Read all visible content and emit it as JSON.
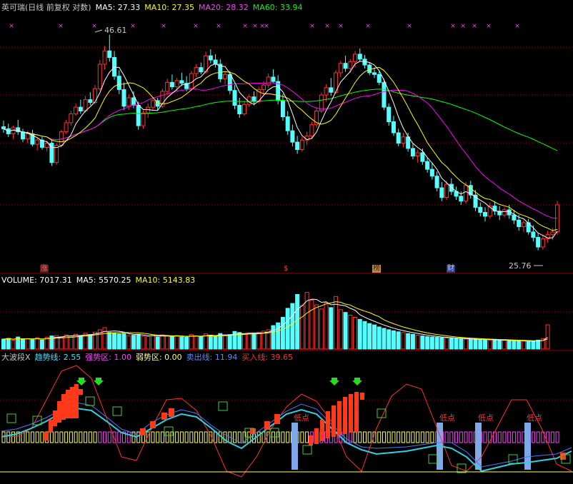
{
  "main": {
    "title": "英可瑞(日线 前复权 对数)",
    "ma5_label": "MA5: 27.33",
    "ma10_label": "MA10: 27.35",
    "ma20_label": "MA20: 28.32",
    "ma60_label": "MA60: 33.94",
    "high_annotation": "46.61",
    "low_annotation": "25.76",
    "event_tags": [
      "涨",
      "$",
      "榜",
      "财"
    ]
  },
  "volume": {
    "label_prefix": "VOLUME: 7017.31",
    "ma5_label": "MA5: 5570.25",
    "ma10_label": "MA10: 5143.83"
  },
  "indicator": {
    "name": "大波段X",
    "trend_label": "趋势线: 2.55",
    "strong_label": "强势区: 1.00",
    "weak_label": "弱势区: 0.00",
    "sell_label": "卖出线: 11.94",
    "buy_label": "买入线: 39.65",
    "low_point_text": "低点"
  },
  "colors": {
    "background": "#000000",
    "up": "#ff3232",
    "down": "#54ffff",
    "ma5": "#ffffff",
    "ma10": "#ffff00",
    "ma20": "#ff00ff",
    "ma60": "#00ff00",
    "grid": "#a00000",
    "trend": "#30d0e0",
    "sell": "#4a7aff",
    "buy": "#ff3030",
    "low_bar": "#7fa8e8"
  },
  "chart_data": {
    "type": "candlestick",
    "title": "英可瑞(日线 前复权 对数)",
    "price_range": [
      25.76,
      46.61
    ],
    "price_high": 46.61,
    "price_low": 25.76,
    "ohlc": [
      [
        36.2,
        36.8,
        35.6,
        36.0
      ],
      [
        36.0,
        36.5,
        35.2,
        35.5
      ],
      [
        35.5,
        36.3,
        35.0,
        36.1
      ],
      [
        36.1,
        36.9,
        35.4,
        35.7
      ],
      [
        35.7,
        36.0,
        34.7,
        35.0
      ],
      [
        35.0,
        35.8,
        34.6,
        35.5
      ],
      [
        35.5,
        35.9,
        34.3,
        34.5
      ],
      [
        34.5,
        35.1,
        33.9,
        34.9
      ],
      [
        34.9,
        35.2,
        34.0,
        34.2
      ],
      [
        34.2,
        34.8,
        33.8,
        34.6
      ],
      [
        34.6,
        35.0,
        32.5,
        32.8
      ],
      [
        32.8,
        34.6,
        32.6,
        34.4
      ],
      [
        34.4,
        35.9,
        34.2,
        35.7
      ],
      [
        35.7,
        36.9,
        35.5,
        36.6
      ],
      [
        36.6,
        37.8,
        36.3,
        37.5
      ],
      [
        37.5,
        38.6,
        37.3,
        38.2
      ],
      [
        38.2,
        39.0,
        37.5,
        37.8
      ],
      [
        37.8,
        39.4,
        37.6,
        39.0
      ],
      [
        39.0,
        39.8,
        38.4,
        38.7
      ],
      [
        38.7,
        40.6,
        38.5,
        40.2
      ],
      [
        40.2,
        43.5,
        40.0,
        43.0
      ],
      [
        43.0,
        45.2,
        42.4,
        44.6
      ],
      [
        44.6,
        46.61,
        43.3,
        43.8
      ],
      [
        43.8,
        44.6,
        41.2,
        41.6
      ],
      [
        41.6,
        42.3,
        39.6,
        40.1
      ],
      [
        40.1,
        40.9,
        37.9,
        38.3
      ],
      [
        38.3,
        39.6,
        37.9,
        39.2
      ],
      [
        39.2,
        39.9,
        38.1,
        38.4
      ],
      [
        38.4,
        38.8,
        35.9,
        36.3
      ],
      [
        36.3,
        37.9,
        36.0,
        37.6
      ],
      [
        37.6,
        38.6,
        37.1,
        38.2
      ],
      [
        38.2,
        39.2,
        37.8,
        38.9
      ],
      [
        38.9,
        39.2,
        37.9,
        38.3
      ],
      [
        38.3,
        40.2,
        38.1,
        39.9
      ],
      [
        39.9,
        41.3,
        39.5,
        40.9
      ],
      [
        40.9,
        41.8,
        40.1,
        40.4
      ],
      [
        40.4,
        41.4,
        39.9,
        41.1
      ],
      [
        41.1,
        42.0,
        40.5,
        40.8
      ],
      [
        40.8,
        41.6,
        39.9,
        40.2
      ],
      [
        40.2,
        42.2,
        40.0,
        41.9
      ],
      [
        41.9,
        43.0,
        41.5,
        42.6
      ],
      [
        42.6,
        43.2,
        41.8,
        42.1
      ],
      [
        42.1,
        44.5,
        41.9,
        44.0
      ],
      [
        44.0,
        44.8,
        43.1,
        43.5
      ],
      [
        43.5,
        44.2,
        42.6,
        43.0
      ],
      [
        43.0,
        43.6,
        40.9,
        41.3
      ],
      [
        41.3,
        42.1,
        40.7,
        41.8
      ],
      [
        41.8,
        42.2,
        39.6,
        40.0
      ],
      [
        40.0,
        40.6,
        38.0,
        38.4
      ],
      [
        38.4,
        39.2,
        37.1,
        37.5
      ],
      [
        37.5,
        38.8,
        37.3,
        38.5
      ],
      [
        38.5,
        39.6,
        38.2,
        39.3
      ],
      [
        39.3,
        39.9,
        38.4,
        38.8
      ],
      [
        38.8,
        40.4,
        38.6,
        40.1
      ],
      [
        40.1,
        41.0,
        39.6,
        40.6
      ],
      [
        40.6,
        41.9,
        40.3,
        41.5
      ],
      [
        41.5,
        42.4,
        40.8,
        41.0
      ],
      [
        41.0,
        41.7,
        38.5,
        38.9
      ],
      [
        38.9,
        39.6,
        36.8,
        37.2
      ],
      [
        37.2,
        37.8,
        35.4,
        35.8
      ],
      [
        35.8,
        36.4,
        34.3,
        34.7
      ],
      [
        34.7,
        35.3,
        33.6,
        34.0
      ],
      [
        34.0,
        35.2,
        33.8,
        34.9
      ],
      [
        34.9,
        35.7,
        34.4,
        35.3
      ],
      [
        35.3,
        36.7,
        35.0,
        36.4
      ],
      [
        36.4,
        38.1,
        36.1,
        37.8
      ],
      [
        37.8,
        39.8,
        37.6,
        39.5
      ],
      [
        39.5,
        40.7,
        38.8,
        40.3
      ],
      [
        40.3,
        41.4,
        39.4,
        39.8
      ],
      [
        39.8,
        42.3,
        39.6,
        42.0
      ],
      [
        42.0,
        43.4,
        41.5,
        43.1
      ],
      [
        43.1,
        44.0,
        42.1,
        42.5
      ],
      [
        42.5,
        43.6,
        42.0,
        43.3
      ],
      [
        43.3,
        44.6,
        42.6,
        44.2
      ],
      [
        44.2,
        44.9,
        43.3,
        43.6
      ],
      [
        43.6,
        44.1,
        42.5,
        42.9
      ],
      [
        42.9,
        43.2,
        41.7,
        42.0
      ],
      [
        42.0,
        42.6,
        41.4,
        41.8
      ],
      [
        41.8,
        42.2,
        40.6,
        40.9
      ],
      [
        40.9,
        41.3,
        37.9,
        38.2
      ],
      [
        38.2,
        38.6,
        36.3,
        36.7
      ],
      [
        36.7,
        37.3,
        35.3,
        35.6
      ],
      [
        35.6,
        36.0,
        34.3,
        34.6
      ],
      [
        34.6,
        35.6,
        34.2,
        35.2
      ],
      [
        35.2,
        35.6,
        33.8,
        34.1
      ],
      [
        34.1,
        34.6,
        33.1,
        33.4
      ],
      [
        33.4,
        34.0,
        32.8,
        33.7
      ],
      [
        33.7,
        34.1,
        32.6,
        32.9
      ],
      [
        32.9,
        33.3,
        31.9,
        32.2
      ],
      [
        32.2,
        32.8,
        31.3,
        31.6
      ],
      [
        31.6,
        32.0,
        30.3,
        30.6
      ],
      [
        30.6,
        31.1,
        29.5,
        29.8
      ],
      [
        29.8,
        31.2,
        29.6,
        30.9
      ],
      [
        30.9,
        31.4,
        30.0,
        30.3
      ],
      [
        30.3,
        30.7,
        29.6,
        29.9
      ],
      [
        29.9,
        30.3,
        29.2,
        29.5
      ],
      [
        29.5,
        31.1,
        29.3,
        30.8
      ],
      [
        30.8,
        31.2,
        29.7,
        30.0
      ],
      [
        30.0,
        30.4,
        28.7,
        29.0
      ],
      [
        29.0,
        29.4,
        28.3,
        28.6
      ],
      [
        28.6,
        29.0,
        27.9,
        28.3
      ],
      [
        28.3,
        29.4,
        28.1,
        29.1
      ],
      [
        29.1,
        29.5,
        28.4,
        28.7
      ],
      [
        28.7,
        29.1,
        28.0,
        28.4
      ],
      [
        28.4,
        29.0,
        28.2,
        28.8
      ],
      [
        28.8,
        29.2,
        28.1,
        28.4
      ],
      [
        28.4,
        28.8,
        27.7,
        28.0
      ],
      [
        28.0,
        28.4,
        27.2,
        27.5
      ],
      [
        27.5,
        28.0,
        27.1,
        27.8
      ],
      [
        27.8,
        28.1,
        26.9,
        27.1
      ],
      [
        27.1,
        27.6,
        26.4,
        26.7
      ],
      [
        26.7,
        27.0,
        25.76,
        26.0
      ],
      [
        26.0,
        26.9,
        25.8,
        26.6
      ],
      [
        26.6,
        27.2,
        26.3,
        26.9
      ],
      [
        26.9,
        27.4,
        26.5,
        27.1
      ],
      [
        27.1,
        29.5,
        26.9,
        29.2
      ]
    ],
    "volume": [
      2900,
      3100,
      2600,
      3500,
      2800,
      3000,
      2700,
      3300,
      2600,
      3400,
      3800,
      3900,
      3600,
      4100,
      3700,
      4300,
      3900,
      4600,
      4200,
      4900,
      5600,
      6200,
      4800,
      4700,
      4400,
      4500,
      3900,
      4000,
      4300,
      3700,
      3600,
      3900,
      3500,
      4100,
      3800,
      3600,
      3900,
      3500,
      3400,
      4200,
      3800,
      3600,
      4400,
      4000,
      3700,
      4500,
      3900,
      4200,
      5100,
      4800,
      4300,
      4600,
      4400,
      4900,
      5200,
      5600,
      6800,
      7600,
      9200,
      11800,
      13200,
      15800,
      12600,
      16400,
      14200,
      12800,
      11600,
      13400,
      12000,
      15200,
      11400,
      10600,
      9800,
      9200,
      8600,
      8000,
      7400,
      7000,
      6400,
      6000,
      5600,
      5300,
      5000,
      4800,
      4500,
      4300,
      4000,
      3800,
      3600,
      3500,
      3400,
      3300,
      3200,
      3100,
      3000,
      2950,
      2900,
      2850,
      2800,
      2750,
      2700,
      2650,
      2600,
      2550,
      2500,
      2450,
      2400,
      2350,
      2300,
      2250,
      2200,
      2600,
      3000,
      7017
    ],
    "series": [
      {
        "name": "MA5",
        "value": 27.33
      },
      {
        "name": "MA10",
        "value": 27.35
      },
      {
        "name": "MA20",
        "value": 28.32
      },
      {
        "name": "MA60",
        "value": 33.94
      }
    ],
    "low_point_markers": 4
  }
}
